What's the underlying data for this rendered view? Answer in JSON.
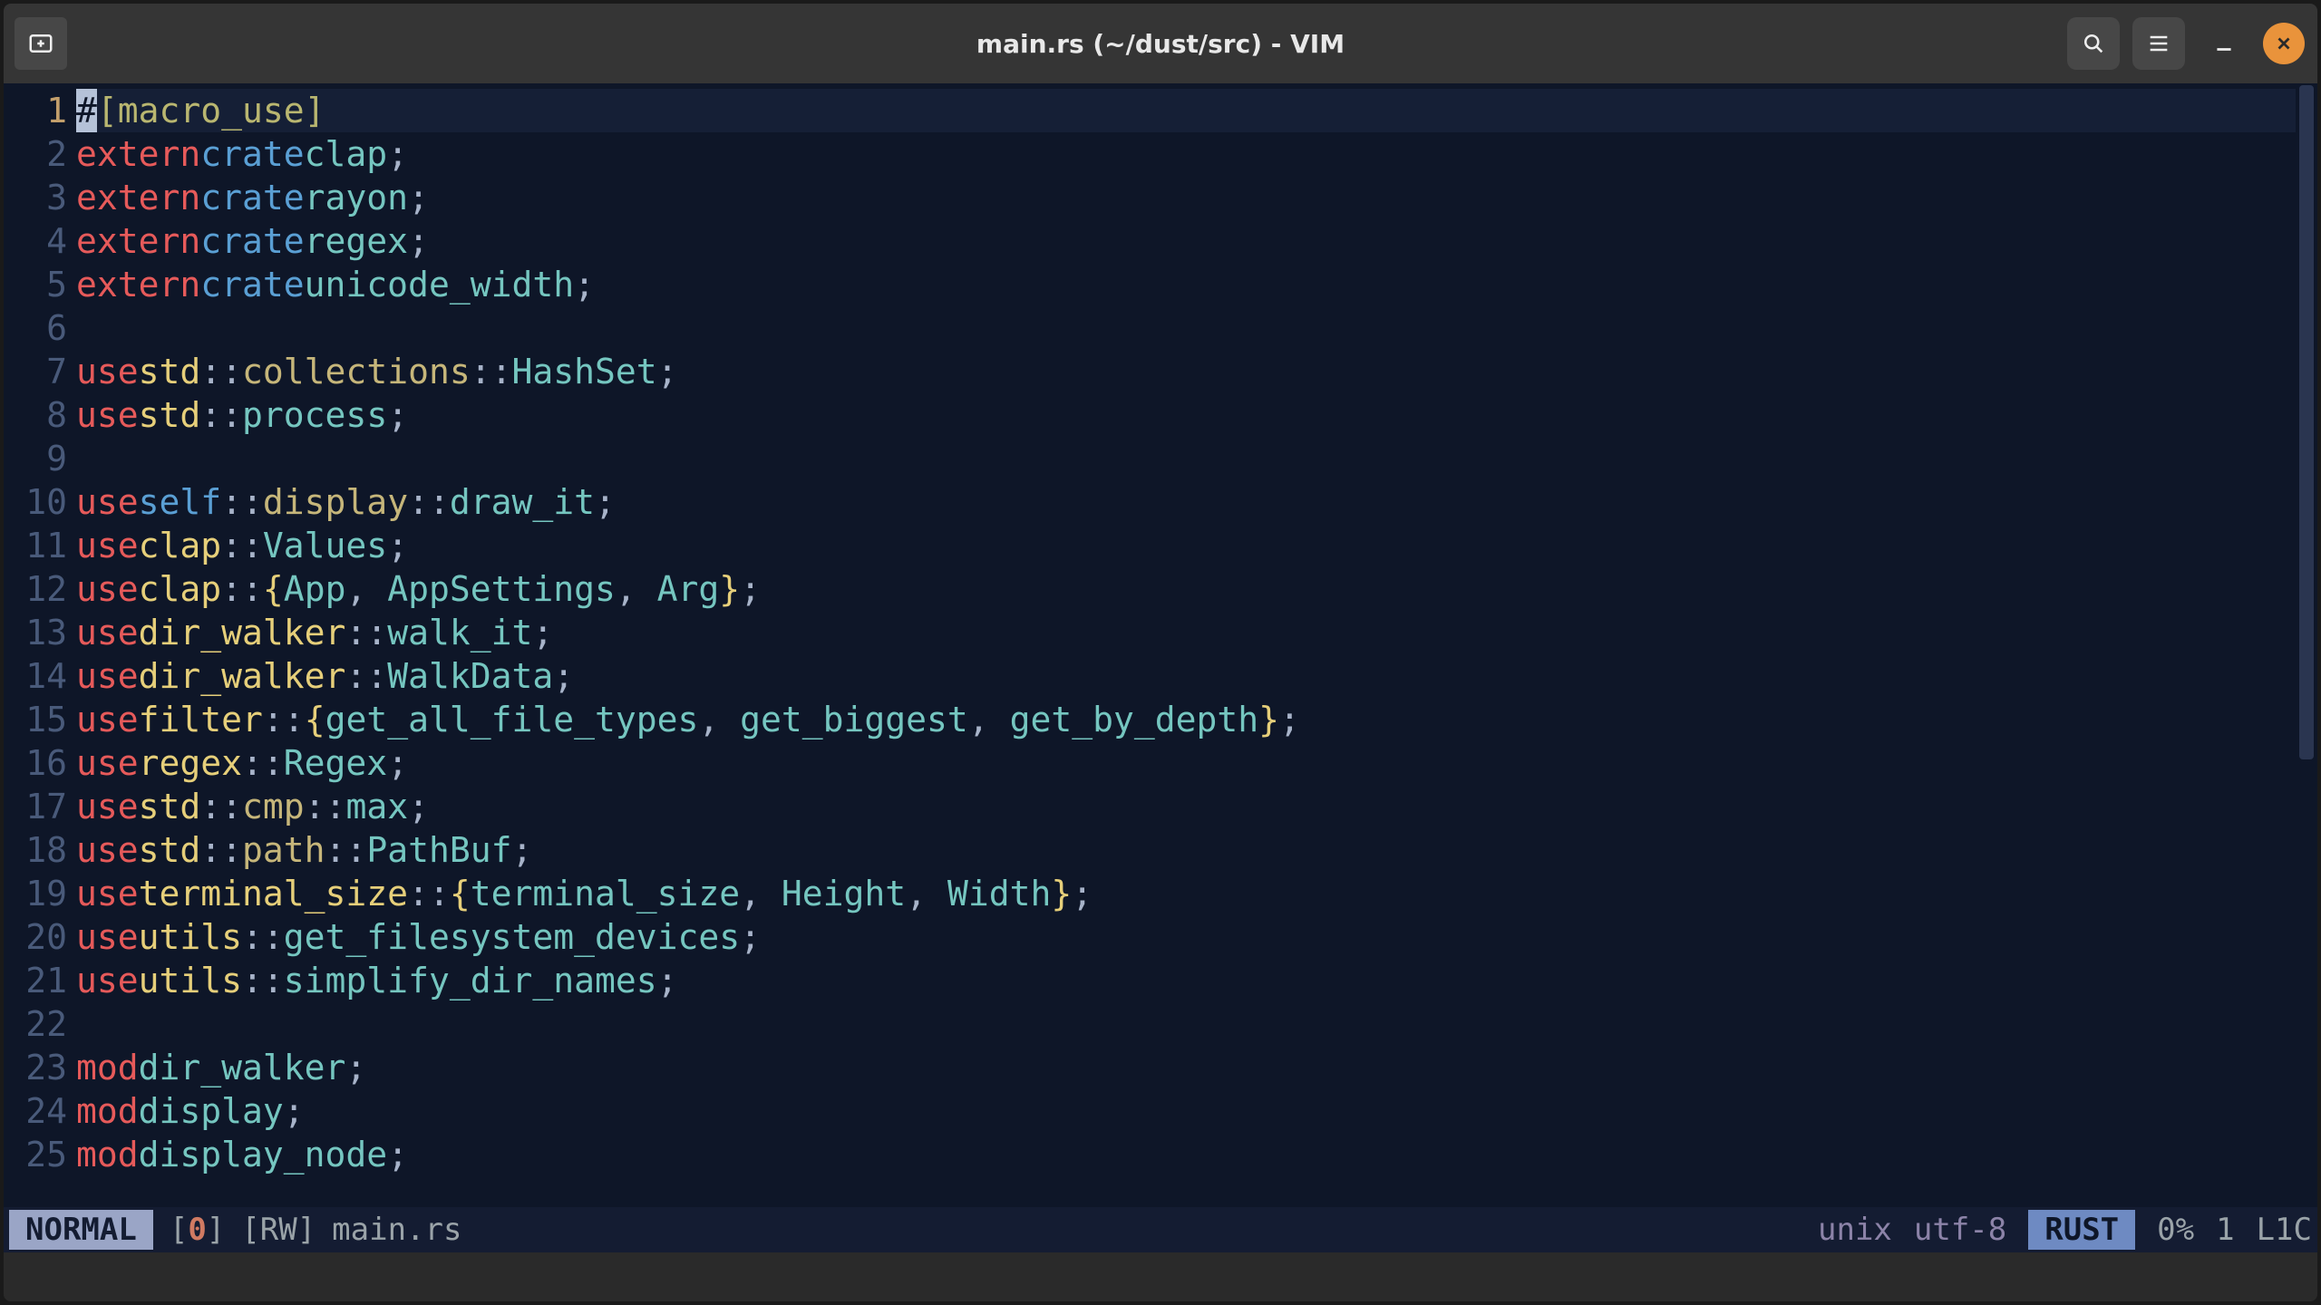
{
  "window": {
    "title": "main.rs (~/dust/src) - VIM"
  },
  "status": {
    "mode": "NORMAL",
    "bufnum_l": "[",
    "bufnum": "0",
    "bufnum_r": "]",
    "rw": "[RW]",
    "filename": "main.rs",
    "format": "unix",
    "encoding": "utf-8",
    "filetype": "RUST",
    "percent": "0%",
    "line": "1",
    "col": "L1C"
  },
  "lines": [
    {
      "n": "1",
      "active": true,
      "tokens": [
        {
          "t": "cursor",
          "s": "#"
        },
        {
          "t": "attr",
          "s": "[macro_use]"
        }
      ]
    },
    {
      "n": "2",
      "tokens": [
        {
          "t": "kw1",
          "s": "extern"
        },
        {
          "t": "sp"
        },
        {
          "t": "kw2",
          "s": "crate"
        },
        {
          "t": "sp"
        },
        {
          "t": "ident",
          "s": "clap"
        },
        {
          "t": "punc",
          "s": ";"
        }
      ]
    },
    {
      "n": "3",
      "tokens": [
        {
          "t": "kw1",
          "s": "extern"
        },
        {
          "t": "sp"
        },
        {
          "t": "kw2",
          "s": "crate"
        },
        {
          "t": "sp"
        },
        {
          "t": "ident",
          "s": "rayon"
        },
        {
          "t": "punc",
          "s": ";"
        }
      ]
    },
    {
      "n": "4",
      "tokens": [
        {
          "t": "kw1",
          "s": "extern"
        },
        {
          "t": "sp"
        },
        {
          "t": "kw2",
          "s": "crate"
        },
        {
          "t": "sp"
        },
        {
          "t": "ident",
          "s": "regex"
        },
        {
          "t": "punc",
          "s": ";"
        }
      ]
    },
    {
      "n": "5",
      "tokens": [
        {
          "t": "kw1",
          "s": "extern"
        },
        {
          "t": "sp"
        },
        {
          "t": "kw2",
          "s": "crate"
        },
        {
          "t": "sp"
        },
        {
          "t": "ident",
          "s": "unicode_width"
        },
        {
          "t": "punc",
          "s": ";"
        }
      ]
    },
    {
      "n": "6",
      "tokens": []
    },
    {
      "n": "7",
      "tokens": [
        {
          "t": "kw1",
          "s": "use"
        },
        {
          "t": "sp"
        },
        {
          "t": "path-a",
          "s": "std"
        },
        {
          "t": "punc",
          "s": "::"
        },
        {
          "t": "path-b",
          "s": "collections"
        },
        {
          "t": "punc",
          "s": "::"
        },
        {
          "t": "ident",
          "s": "HashSet"
        },
        {
          "t": "punc",
          "s": ";"
        }
      ]
    },
    {
      "n": "8",
      "tokens": [
        {
          "t": "kw1",
          "s": "use"
        },
        {
          "t": "sp"
        },
        {
          "t": "path-a",
          "s": "std"
        },
        {
          "t": "punc",
          "s": "::"
        },
        {
          "t": "ident",
          "s": "process"
        },
        {
          "t": "punc",
          "s": ";"
        }
      ]
    },
    {
      "n": "9",
      "tokens": []
    },
    {
      "n": "10",
      "tokens": [
        {
          "t": "kw1",
          "s": "use"
        },
        {
          "t": "sp"
        },
        {
          "t": "kw2",
          "s": "self"
        },
        {
          "t": "punc",
          "s": "::"
        },
        {
          "t": "path-b",
          "s": "display"
        },
        {
          "t": "punc",
          "s": "::"
        },
        {
          "t": "ident",
          "s": "draw_it"
        },
        {
          "t": "punc",
          "s": ";"
        }
      ]
    },
    {
      "n": "11",
      "tokens": [
        {
          "t": "kw1",
          "s": "use"
        },
        {
          "t": "sp"
        },
        {
          "t": "path-a",
          "s": "clap"
        },
        {
          "t": "punc",
          "s": "::"
        },
        {
          "t": "ident",
          "s": "Values"
        },
        {
          "t": "punc",
          "s": ";"
        }
      ]
    },
    {
      "n": "12",
      "tokens": [
        {
          "t": "kw1",
          "s": "use"
        },
        {
          "t": "sp"
        },
        {
          "t": "path-a",
          "s": "clap"
        },
        {
          "t": "punc",
          "s": "::"
        },
        {
          "t": "brace",
          "s": "{"
        },
        {
          "t": "ident",
          "s": "App"
        },
        {
          "t": "punc",
          "s": ", "
        },
        {
          "t": "ident",
          "s": "AppSettings"
        },
        {
          "t": "punc",
          "s": ", "
        },
        {
          "t": "ident",
          "s": "Arg"
        },
        {
          "t": "brace",
          "s": "}"
        },
        {
          "t": "punc",
          "s": ";"
        }
      ]
    },
    {
      "n": "13",
      "tokens": [
        {
          "t": "kw1",
          "s": "use"
        },
        {
          "t": "sp"
        },
        {
          "t": "path-a",
          "s": "dir_walker"
        },
        {
          "t": "punc",
          "s": "::"
        },
        {
          "t": "ident",
          "s": "walk_it"
        },
        {
          "t": "punc",
          "s": ";"
        }
      ]
    },
    {
      "n": "14",
      "tokens": [
        {
          "t": "kw1",
          "s": "use"
        },
        {
          "t": "sp"
        },
        {
          "t": "path-a",
          "s": "dir_walker"
        },
        {
          "t": "punc",
          "s": "::"
        },
        {
          "t": "ident",
          "s": "WalkData"
        },
        {
          "t": "punc",
          "s": ";"
        }
      ]
    },
    {
      "n": "15",
      "tokens": [
        {
          "t": "kw1",
          "s": "use"
        },
        {
          "t": "sp"
        },
        {
          "t": "path-a",
          "s": "filter"
        },
        {
          "t": "punc",
          "s": "::"
        },
        {
          "t": "brace",
          "s": "{"
        },
        {
          "t": "ident",
          "s": "get_all_file_types"
        },
        {
          "t": "punc",
          "s": ", "
        },
        {
          "t": "ident",
          "s": "get_biggest"
        },
        {
          "t": "punc",
          "s": ", "
        },
        {
          "t": "ident",
          "s": "get_by_depth"
        },
        {
          "t": "brace",
          "s": "}"
        },
        {
          "t": "punc",
          "s": ";"
        }
      ]
    },
    {
      "n": "16",
      "tokens": [
        {
          "t": "kw1",
          "s": "use"
        },
        {
          "t": "sp"
        },
        {
          "t": "path-a",
          "s": "regex"
        },
        {
          "t": "punc",
          "s": "::"
        },
        {
          "t": "ident",
          "s": "Regex"
        },
        {
          "t": "punc",
          "s": ";"
        }
      ]
    },
    {
      "n": "17",
      "tokens": [
        {
          "t": "kw1",
          "s": "use"
        },
        {
          "t": "sp"
        },
        {
          "t": "path-a",
          "s": "std"
        },
        {
          "t": "punc",
          "s": "::"
        },
        {
          "t": "path-b",
          "s": "cmp"
        },
        {
          "t": "punc",
          "s": "::"
        },
        {
          "t": "ident",
          "s": "max"
        },
        {
          "t": "punc",
          "s": ";"
        }
      ]
    },
    {
      "n": "18",
      "tokens": [
        {
          "t": "kw1",
          "s": "use"
        },
        {
          "t": "sp"
        },
        {
          "t": "path-a",
          "s": "std"
        },
        {
          "t": "punc",
          "s": "::"
        },
        {
          "t": "path-b",
          "s": "path"
        },
        {
          "t": "punc",
          "s": "::"
        },
        {
          "t": "ident",
          "s": "PathBuf"
        },
        {
          "t": "punc",
          "s": ";"
        }
      ]
    },
    {
      "n": "19",
      "tokens": [
        {
          "t": "kw1",
          "s": "use"
        },
        {
          "t": "sp"
        },
        {
          "t": "path-a",
          "s": "terminal_size"
        },
        {
          "t": "punc",
          "s": "::"
        },
        {
          "t": "brace",
          "s": "{"
        },
        {
          "t": "ident",
          "s": "terminal_size"
        },
        {
          "t": "punc",
          "s": ", "
        },
        {
          "t": "ident",
          "s": "Height"
        },
        {
          "t": "punc",
          "s": ", "
        },
        {
          "t": "ident",
          "s": "Width"
        },
        {
          "t": "brace",
          "s": "}"
        },
        {
          "t": "punc",
          "s": ";"
        }
      ]
    },
    {
      "n": "20",
      "tokens": [
        {
          "t": "kw1",
          "s": "use"
        },
        {
          "t": "sp"
        },
        {
          "t": "path-a",
          "s": "utils"
        },
        {
          "t": "punc",
          "s": "::"
        },
        {
          "t": "ident",
          "s": "get_filesystem_devices"
        },
        {
          "t": "punc",
          "s": ";"
        }
      ]
    },
    {
      "n": "21",
      "tokens": [
        {
          "t": "kw1",
          "s": "use"
        },
        {
          "t": "sp"
        },
        {
          "t": "path-a",
          "s": "utils"
        },
        {
          "t": "punc",
          "s": "::"
        },
        {
          "t": "ident",
          "s": "simplify_dir_names"
        },
        {
          "t": "punc",
          "s": ";"
        }
      ]
    },
    {
      "n": "22",
      "tokens": []
    },
    {
      "n": "23",
      "tokens": [
        {
          "t": "kw1",
          "s": "mod"
        },
        {
          "t": "sp"
        },
        {
          "t": "ident",
          "s": "dir_walker"
        },
        {
          "t": "punc",
          "s": ";"
        }
      ]
    },
    {
      "n": "24",
      "tokens": [
        {
          "t": "kw1",
          "s": "mod"
        },
        {
          "t": "sp"
        },
        {
          "t": "ident",
          "s": "display"
        },
        {
          "t": "punc",
          "s": ";"
        }
      ]
    },
    {
      "n": "25",
      "tokens": [
        {
          "t": "kw1",
          "s": "mod"
        },
        {
          "t": "sp"
        },
        {
          "t": "ident",
          "s": "display_node"
        },
        {
          "t": "punc",
          "s": ";"
        }
      ]
    }
  ]
}
